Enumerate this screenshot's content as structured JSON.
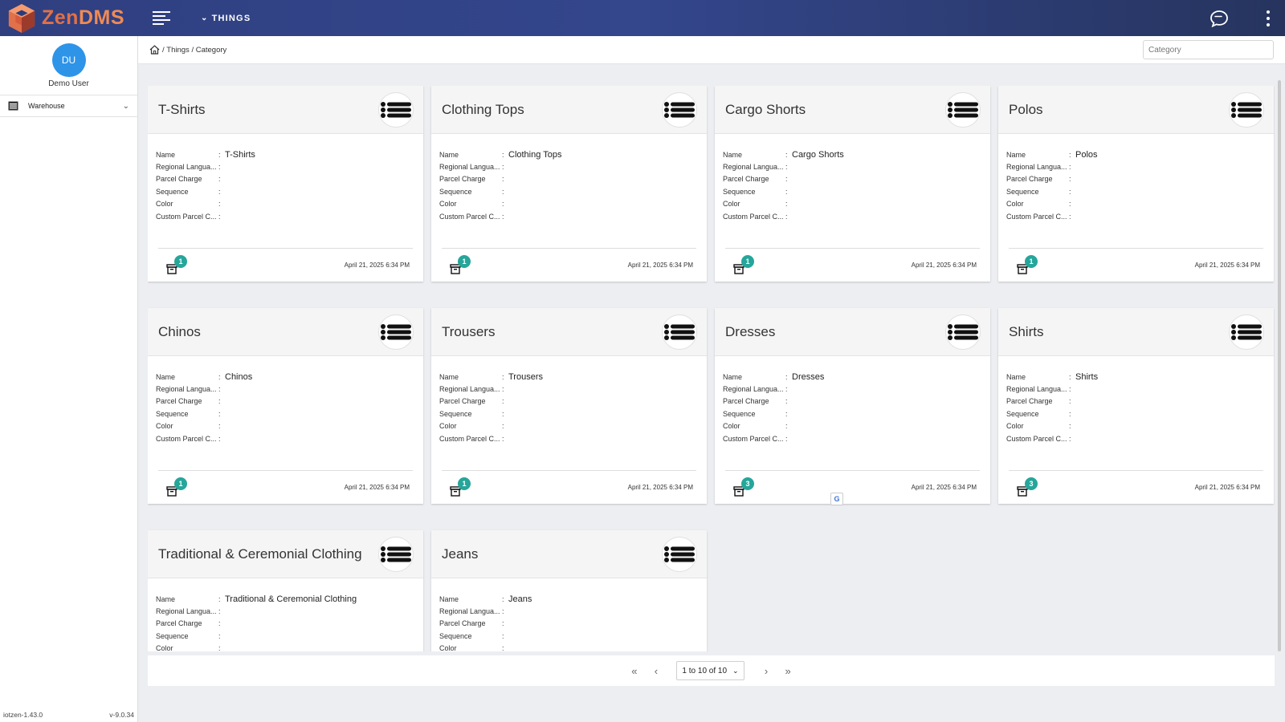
{
  "app": {
    "logo_zen": "Zen",
    "logo_dms": "DMS",
    "menu": "THINGS"
  },
  "user": {
    "initials": "DU",
    "name": "Demo User"
  },
  "sidebar": {
    "items": [
      {
        "label": "Warehouse"
      }
    ],
    "footer_left": "iotzen-1.43.0",
    "footer_right": "v-9.0.34"
  },
  "breadcrumb": {
    "sep1": "/",
    "things": "Things",
    "sep2": "/",
    "current": "Category"
  },
  "search": {
    "placeholder": "Category",
    "value": ""
  },
  "field_labels": [
    "Name",
    "Regional Langua...",
    "Parcel Charge",
    "Sequence",
    "Color",
    "Custom Parcel C..."
  ],
  "cards": [
    {
      "title": "T-Shirts",
      "name": "T-Shirts",
      "count": "1",
      "date": "April 21, 2025 6:34 PM"
    },
    {
      "title": "Clothing Tops",
      "name": "Clothing Tops",
      "count": "1",
      "date": "April 21, 2025 6:34 PM"
    },
    {
      "title": "Cargo Shorts",
      "name": "Cargo Shorts",
      "count": "1",
      "date": "April 21, 2025 6:34 PM"
    },
    {
      "title": "Polos",
      "name": "Polos",
      "count": "1",
      "date": "April 21, 2025 6:34 PM"
    },
    {
      "title": "Chinos",
      "name": "Chinos",
      "count": "1",
      "date": "April 21, 2025 6:34 PM"
    },
    {
      "title": "Trousers",
      "name": "Trousers",
      "count": "1",
      "date": "April 21, 2025 6:34 PM"
    },
    {
      "title": "Dresses",
      "name": "Dresses",
      "count": "3",
      "date": "April 21, 2025 6:34 PM"
    },
    {
      "title": "Shirts",
      "name": "Shirts",
      "count": "3",
      "date": "April 21, 2025 6:34 PM"
    },
    {
      "title": "Traditional & Ceremonial Clothing",
      "name": "Traditional & Ceremonial Clothing",
      "count": "",
      "date": ""
    },
    {
      "title": "Jeans",
      "name": "Jeans",
      "count": "",
      "date": ""
    }
  ],
  "pagination": {
    "first": "«",
    "prev": "‹",
    "range": "1 to 10 of 10",
    "next": "›",
    "last": "»"
  },
  "colors": {
    "topbar": "#34468c",
    "accent": "#2e94e8",
    "badge": "#26a69a",
    "logo": "#e0714a"
  },
  "icons": [
    "cube-logo-icon",
    "hamburger-icon",
    "chat-icon",
    "more-vertical-icon",
    "warehouse-icon",
    "home-icon",
    "list-icon",
    "archive-icon",
    "translate-icon"
  ]
}
